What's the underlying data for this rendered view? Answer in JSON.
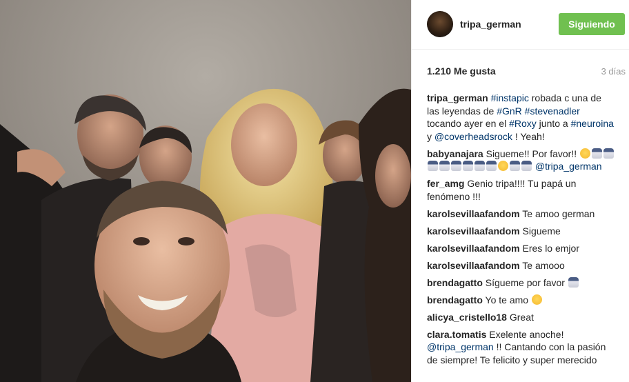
{
  "post": {
    "author": "tripa_german",
    "follow_label": "Siguiendo",
    "likes": "1.210 Me gusta",
    "time_ago": "3 días"
  },
  "photo": {
    "icon": "group-selfie-photo",
    "colors": {
      "wall": "#a39d96",
      "skin": "#d8a98c",
      "hair_blonde": "#e6cf85",
      "shirt_pink": "#e8b2aa"
    }
  },
  "caption": {
    "user": "tripa_german",
    "parts": [
      {
        "t": "tag",
        "v": "#instapic"
      },
      {
        "t": "txt",
        "v": " robada c una de las leyendas de "
      },
      {
        "t": "tag",
        "v": "#GnR"
      },
      {
        "t": "txt",
        "v": " "
      },
      {
        "t": "tag",
        "v": "#stevenadler"
      },
      {
        "t": "txt",
        "v": " tocando ayer en el "
      },
      {
        "t": "tag",
        "v": "#Roxy"
      },
      {
        "t": "txt",
        "v": " junto a "
      },
      {
        "t": "tag",
        "v": "#neuroina"
      },
      {
        "t": "txt",
        "v": " y "
      },
      {
        "t": "tag",
        "v": "@coverheadsrock"
      },
      {
        "t": "txt",
        "v": " ! Yeah!"
      }
    ]
  },
  "comments": [
    {
      "user": "babyanajara",
      "parts": [
        {
          "t": "txt",
          "v": "Sigueme!! Por favor!! "
        },
        {
          "t": "emoji",
          "v": "smile-emoji"
        },
        {
          "t": "emoji",
          "v": "nun-emoji"
        },
        {
          "t": "emoji",
          "v": "nun-emoji"
        },
        {
          "t": "emoji",
          "v": "nun-emoji"
        },
        {
          "t": "emoji",
          "v": "nun-emoji"
        },
        {
          "t": "emoji",
          "v": "nun-emoji"
        },
        {
          "t": "emoji",
          "v": "nun-emoji"
        },
        {
          "t": "emoji",
          "v": "nun-emoji"
        },
        {
          "t": "emoji",
          "v": "nun-emoji"
        },
        {
          "t": "emoji",
          "v": "smile-emoji"
        },
        {
          "t": "emoji",
          "v": "nun-emoji"
        },
        {
          "t": "emoji",
          "v": "nun-emoji"
        },
        {
          "t": "txt",
          "v": " "
        },
        {
          "t": "tag",
          "v": "@tripa_german"
        }
      ]
    },
    {
      "user": "fer_amg",
      "parts": [
        {
          "t": "txt",
          "v": "Genio tripa!!!! Tu papá un fenómeno !!!"
        }
      ]
    },
    {
      "user": "karolsevillaafandom",
      "parts": [
        {
          "t": "txt",
          "v": "Te amoo german"
        }
      ]
    },
    {
      "user": "karolsevillaafandom",
      "parts": [
        {
          "t": "txt",
          "v": "Sigueme"
        }
      ]
    },
    {
      "user": "karolsevillaafandom",
      "parts": [
        {
          "t": "txt",
          "v": "Eres lo emjor"
        }
      ]
    },
    {
      "user": "karolsevillaafandom",
      "parts": [
        {
          "t": "txt",
          "v": "Te amooo"
        }
      ]
    },
    {
      "user": "brendagatto",
      "parts": [
        {
          "t": "txt",
          "v": "Sígueme por favor "
        },
        {
          "t": "emoji",
          "v": "nun-emoji"
        }
      ]
    },
    {
      "user": "brendagatto",
      "parts": [
        {
          "t": "txt",
          "v": "Yo te amo "
        },
        {
          "t": "emoji",
          "v": "smile-emoji"
        }
      ]
    },
    {
      "user": "alicya_cristello18",
      "parts": [
        {
          "t": "txt",
          "v": "Great"
        }
      ]
    },
    {
      "user": "clara.tomatis",
      "parts": [
        {
          "t": "txt",
          "v": "Exelente anoche! "
        },
        {
          "t": "tag",
          "v": "@tripa_german"
        },
        {
          "t": "txt",
          "v": " !! Cantando con la pasión de siempre! Te felicito y super merecido"
        }
      ]
    }
  ]
}
